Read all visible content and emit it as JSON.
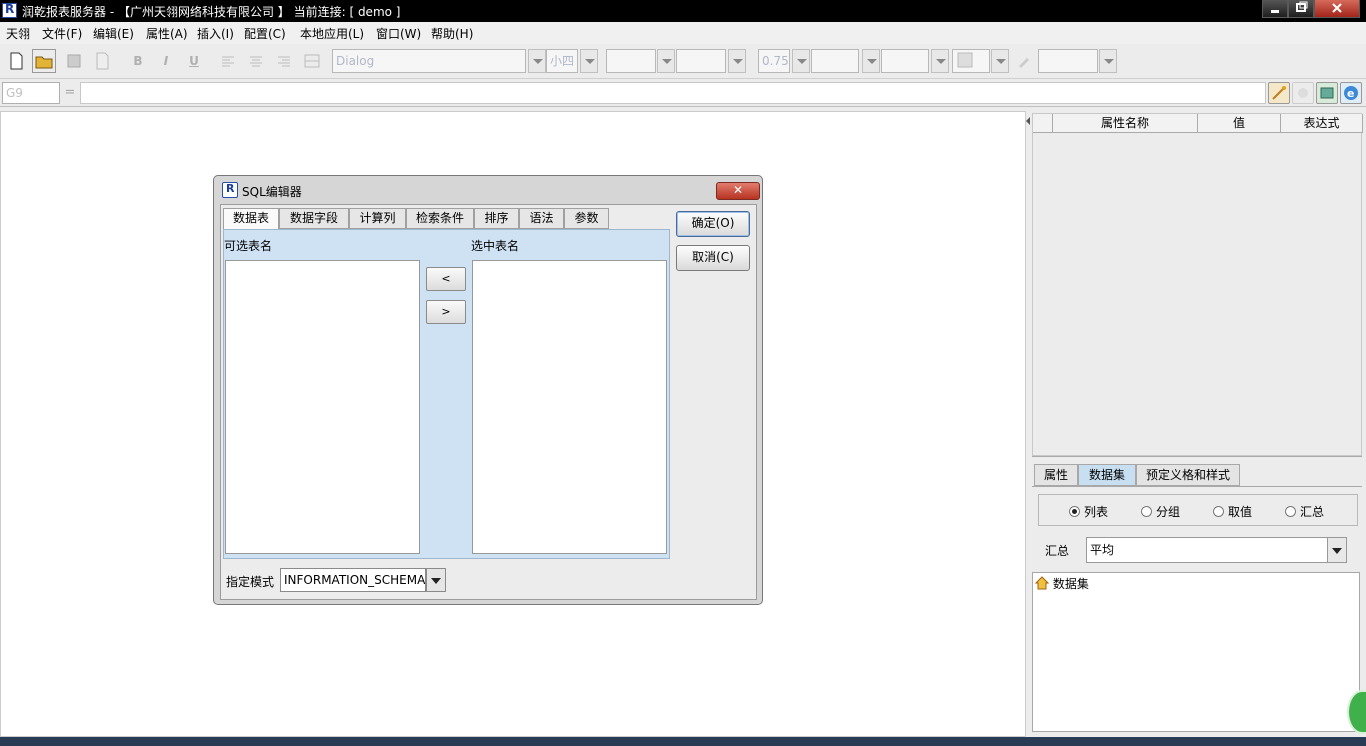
{
  "window": {
    "title": "润乾报表服务器 - 【广州天翎网络科技有限公司 】  当前连接: [ demo ]",
    "min_icon": "minimize-icon",
    "max_icon": "maximize-icon",
    "close_icon": "close-icon"
  },
  "menubar": {
    "items": [
      "天翎",
      "文件(F)",
      "编辑(E)",
      "属性(A)",
      "插入(I)",
      "配置(C)",
      "本地应用(L)",
      "窗口(W)",
      "帮助(H)"
    ]
  },
  "toolbar": {
    "font_name": "Dialog",
    "font_size": "小四",
    "border_width": "0.75",
    "bold": "B",
    "italic": "I",
    "underline": "U"
  },
  "formula_bar": {
    "cell_ref": "G9",
    "eq_symbol": "="
  },
  "property_panel": {
    "columns": [
      "属性名称",
      "值",
      "表达式"
    ],
    "tabs": [
      "属性",
      "数据集",
      "预定义格和样式"
    ],
    "selected_tab": "数据集",
    "radios": [
      "列表",
      "分组",
      "取值",
      "汇总"
    ],
    "selected_radio": "列表",
    "summary_label": "汇总",
    "summary_value": "平均",
    "tree_root": "数据集"
  },
  "dialog": {
    "title": "SQL编辑器",
    "close_symbol": "✕",
    "tabs": [
      "数据表",
      "数据字段",
      "计算列",
      "检索条件",
      "排序",
      "语法",
      "参数"
    ],
    "selected_tab": "数据表",
    "available_label": "可选表名",
    "selected_label": "选中表名",
    "move_left": "<",
    "move_right": ">",
    "ok_button": "确定(O)",
    "cancel_button": "取消(C)",
    "schema_label": "指定模式",
    "schema_value": "INFORMATION_SCHEMA"
  },
  "colors": {
    "titlebar": "#000000",
    "tab_panel_bg": "#cfe2f3",
    "selected_tab_bg": "#c7dff0"
  }
}
